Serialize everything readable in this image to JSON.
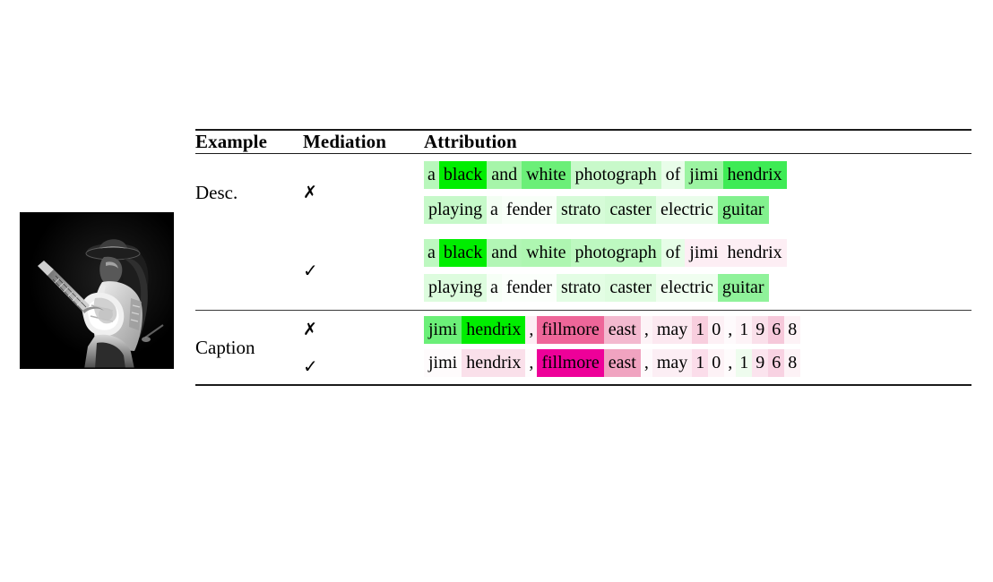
{
  "figure": {
    "thumbnail_alt": "black and white photograph of jimi hendrix playing a fender stratocaster electric guitar"
  },
  "table": {
    "columns": [
      "Example",
      "Mediation",
      "Attribution"
    ],
    "marks": {
      "cross": "✗",
      "check": "✓"
    },
    "colors": {
      "green_max": "#00ee00",
      "green_strong": "#55ee66",
      "green_mid": "#8cf291",
      "green_light": "#b8f7bb",
      "green_faint": "#dcfcdd",
      "green_trace": "#effeef",
      "pink_max": "#ee0099",
      "pink_strong": "#ee6699",
      "pink_mid": "#f0a3c0",
      "pink_light": "#f8cede",
      "pink_faint": "#fbe2ec",
      "pink_trace": "#fdf1f5",
      "white": "#ffffff"
    },
    "rows": [
      {
        "example": "Desc.",
        "mediation": "✗",
        "lines": [
          [
            {
              "t": "a",
              "bg": "#b8f7bb"
            },
            {
              "t": "black",
              "bg": "#00ee00"
            },
            {
              "t": "and",
              "bg": "#a6f5a9"
            },
            {
              "t": "white",
              "bg": "#6bef78"
            },
            {
              "t": "photograph",
              "bg": "#c8f9ca"
            },
            {
              "t": "of",
              "bg": "#e8fde9"
            },
            {
              "t": "jimi",
              "bg": "#9cf4a2"
            },
            {
              "t": "hendrix",
              "bg": "#3eeb55"
            }
          ],
          [
            {
              "t": "playing",
              "bg": "#c6f9c9"
            },
            {
              "t": "a",
              "bg": "#f3fef3"
            },
            {
              "t": "fender",
              "bg": "#f8fff8"
            },
            {
              "t": "strato",
              "bg": "#d6fbd8"
            },
            {
              "t": "caster",
              "bg": "#d0fad2"
            },
            {
              "t": "electric",
              "bg": "#eafdeb"
            },
            {
              "t": "guitar",
              "bg": "#82f18e"
            }
          ]
        ]
      },
      {
        "example": "",
        "mediation": "✓",
        "lines": [
          [
            {
              "t": "a",
              "bg": "#bdf8c0"
            },
            {
              "t": "black",
              "bg": "#00ee00"
            },
            {
              "t": "and",
              "bg": "#b2f6b5"
            },
            {
              "t": "white",
              "bg": "#aef6b1"
            },
            {
              "t": "photograph",
              "bg": "#bdf8c0"
            },
            {
              "t": "of",
              "bg": "#e6fde7"
            },
            {
              "t": "jimi",
              "bg": "#fdeef4"
            },
            {
              "t": "hendrix",
              "bg": "#fdeef4"
            }
          ],
          [
            {
              "t": "playing",
              "bg": "#ddfcde"
            },
            {
              "t": "a",
              "bg": "#f6fff6"
            },
            {
              "t": "fender",
              "bg": "#fbfffb"
            },
            {
              "t": "strato",
              "bg": "#e3fde4"
            },
            {
              "t": "caster",
              "bg": "#defcdf"
            },
            {
              "t": "electric",
              "bg": "#f0fef0"
            },
            {
              "t": "guitar",
              "bg": "#8ff29a"
            }
          ]
        ]
      },
      {
        "example": "Caption",
        "mediation": "✗",
        "lines": [
          [
            {
              "t": "jimi",
              "bg": "#6bef78"
            },
            {
              "t": "hendrix",
              "bg": "#00ee00"
            },
            {
              "t": ",",
              "bg": "#fdeef4"
            },
            {
              "t": "fillmore",
              "bg": "#ee6699"
            },
            {
              "t": "east",
              "bg": "#f3b9cf"
            },
            {
              "t": ",",
              "bg": "#fdf3f7"
            },
            {
              "t": "may",
              "bg": "#fce8f0"
            },
            {
              "t": "1",
              "bg": "#f8cede"
            },
            {
              "t": "0",
              "bg": "#fdf0f5"
            },
            {
              "t": ",",
              "bg": "#fefafc"
            },
            {
              "t": "1",
              "bg": "#fdf3f7"
            },
            {
              "t": "9",
              "bg": "#fae0ea"
            },
            {
              "t": "6",
              "bg": "#f6c8da"
            },
            {
              "t": "8",
              "bg": "#fdf2f6"
            }
          ]
        ]
      },
      {
        "example": "",
        "mediation": "✓",
        "lines": [
          [
            {
              "t": "jimi",
              "bg": "#fefbfc"
            },
            {
              "t": "hendrix",
              "bg": "#fae0ea"
            },
            {
              "t": ",",
              "bg": "#fefcfd"
            },
            {
              "t": "fillmore",
              "bg": "#ee0099"
            },
            {
              "t": "east",
              "bg": "#f0a3c0"
            },
            {
              "t": ",",
              "bg": "#fefafc"
            },
            {
              "t": "may",
              "bg": "#fceef4"
            },
            {
              "t": "1",
              "bg": "#fbddea"
            },
            {
              "t": "0",
              "bg": "#fdf2f6"
            },
            {
              "t": ",",
              "bg": "#fefbfc"
            },
            {
              "t": "1",
              "bg": "#eefcee"
            },
            {
              "t": "9",
              "bg": "#fbe4ee"
            },
            {
              "t": "6",
              "bg": "#f8d2e2"
            },
            {
              "t": "8",
              "bg": "#fdf2f6"
            }
          ]
        ]
      }
    ]
  }
}
